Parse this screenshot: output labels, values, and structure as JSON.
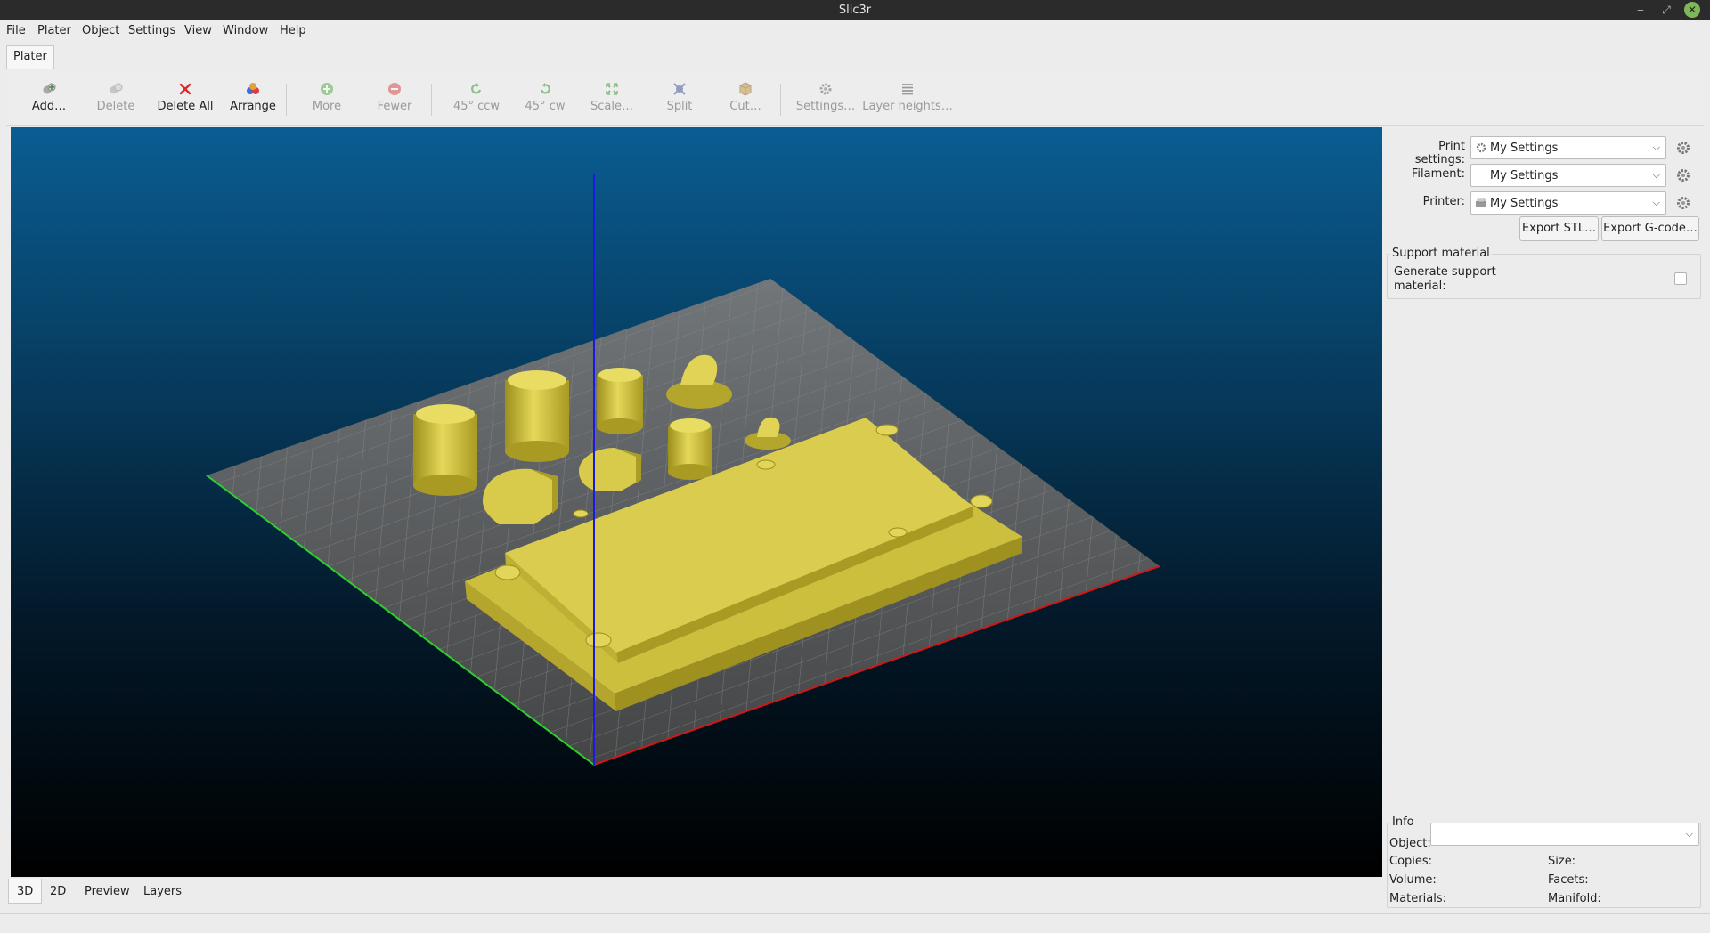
{
  "window": {
    "title": "Slic3r"
  },
  "menu": [
    "File",
    "Plater",
    "Object",
    "Settings",
    "View",
    "Window",
    "Help"
  ],
  "tabs": {
    "plater": "Plater"
  },
  "toolbar": {
    "add": "Add…",
    "delete": "Delete",
    "delete_all": "Delete All",
    "arrange": "Arrange",
    "more": "More",
    "fewer": "Fewer",
    "rotate_ccw": "45° ccw",
    "rotate_cw": "45° cw",
    "scale": "Scale…",
    "split": "Split",
    "cut": "Cut…",
    "settings": "Settings…",
    "layer_heights": "Layer heights…"
  },
  "view_tabs": [
    "3D",
    "2D",
    "Preview",
    "Layers"
  ],
  "right_panel": {
    "print_settings_label": "Print settings:",
    "print_settings_value": "My Settings",
    "filament_label": "Filament:",
    "filament_value": "My Settings",
    "printer_label": "Printer:",
    "printer_value": "My Settings",
    "export_stl": "Export STL…",
    "export_gcode": "Export G-code…",
    "support_title": "Support material",
    "generate_support_l1": "Generate support",
    "generate_support_l2": "material:",
    "generate_support_checked": false
  },
  "info": {
    "title": "Info",
    "object_label": "Object:",
    "object_value": "",
    "copies_label": "Copies:",
    "size_label": "Size:",
    "volume_label": "Volume:",
    "facets_label": "Facets:",
    "materials_label": "Materials:",
    "manifold_label": "Manifold:"
  },
  "colors": {
    "model": "#d6c94a",
    "bed": "#6b6b6b",
    "x_axis": "#d01818",
    "y_axis": "#2bd02b",
    "z_axis": "#1a1ae0",
    "background_top": "#0a5d92",
    "background_bottom": "#000000"
  }
}
